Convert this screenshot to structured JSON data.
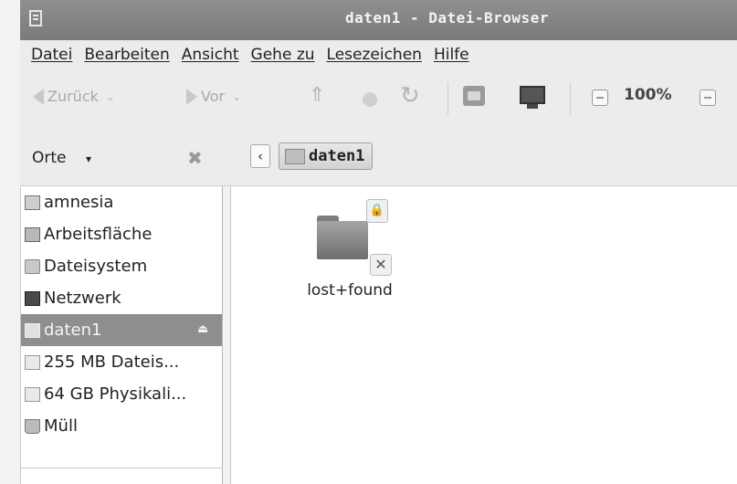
{
  "window": {
    "title": "daten1 - Datei-Browser"
  },
  "menubar": {
    "items": [
      "Datei",
      "Bearbeiten",
      "Ansicht",
      "Gehe zu",
      "Lesezeichen",
      "Hilfe"
    ]
  },
  "toolbar": {
    "back_label": "Zurück",
    "forward_label": "Vor",
    "zoom": "100%"
  },
  "location": {
    "places_label": "Orte",
    "breadcrumb": "daten1"
  },
  "sidebar": {
    "items": [
      {
        "label": "amnesia",
        "icon": "home-folder-icon"
      },
      {
        "label": "Arbeitsfläche",
        "icon": "desktop-folder-icon"
      },
      {
        "label": "Dateisystem",
        "icon": "filesystem-icon"
      },
      {
        "label": "Netzwerk",
        "icon": "network-icon"
      },
      {
        "label": "daten1",
        "icon": "drive-icon",
        "selected": true
      },
      {
        "label": "255 MB Dateis...",
        "icon": "drive-icon"
      },
      {
        "label": "64 GB Physikali...",
        "icon": "drive-icon"
      },
      {
        "label": "Müll",
        "icon": "trash-icon"
      }
    ]
  },
  "content": {
    "items": [
      {
        "name": "lost+found",
        "icon": "folder-icon",
        "emblems": [
          "lock",
          "cannot-write"
        ]
      }
    ]
  }
}
